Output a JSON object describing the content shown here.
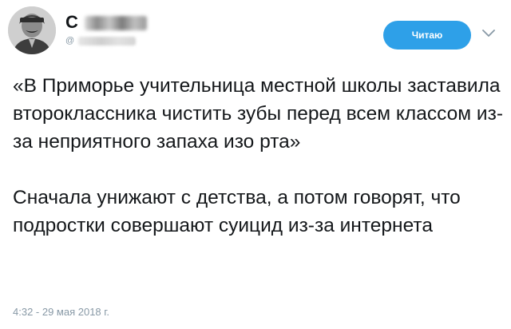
{
  "user": {
    "display_name": "С",
    "handle": "@",
    "avatar_icon": "user-avatar-icon"
  },
  "follow_button": {
    "label": "Читаю"
  },
  "menu": {
    "icon": "chevron-down-icon"
  },
  "tweet": {
    "paragraphs": [
      "«В Приморье учительница местной школы заставила второклассника чистить зубы перед всем классом из-за неприятного запаха изо рта»",
      "Сначала унижают с детства, а потом говорят, что подростки совершают суицид из-за интернета"
    ],
    "timestamp": "4:32 - 29 мая 2018 г."
  },
  "colors": {
    "accent": "#2ea0e8",
    "text": "#14171a",
    "muted": "#8899a6"
  }
}
